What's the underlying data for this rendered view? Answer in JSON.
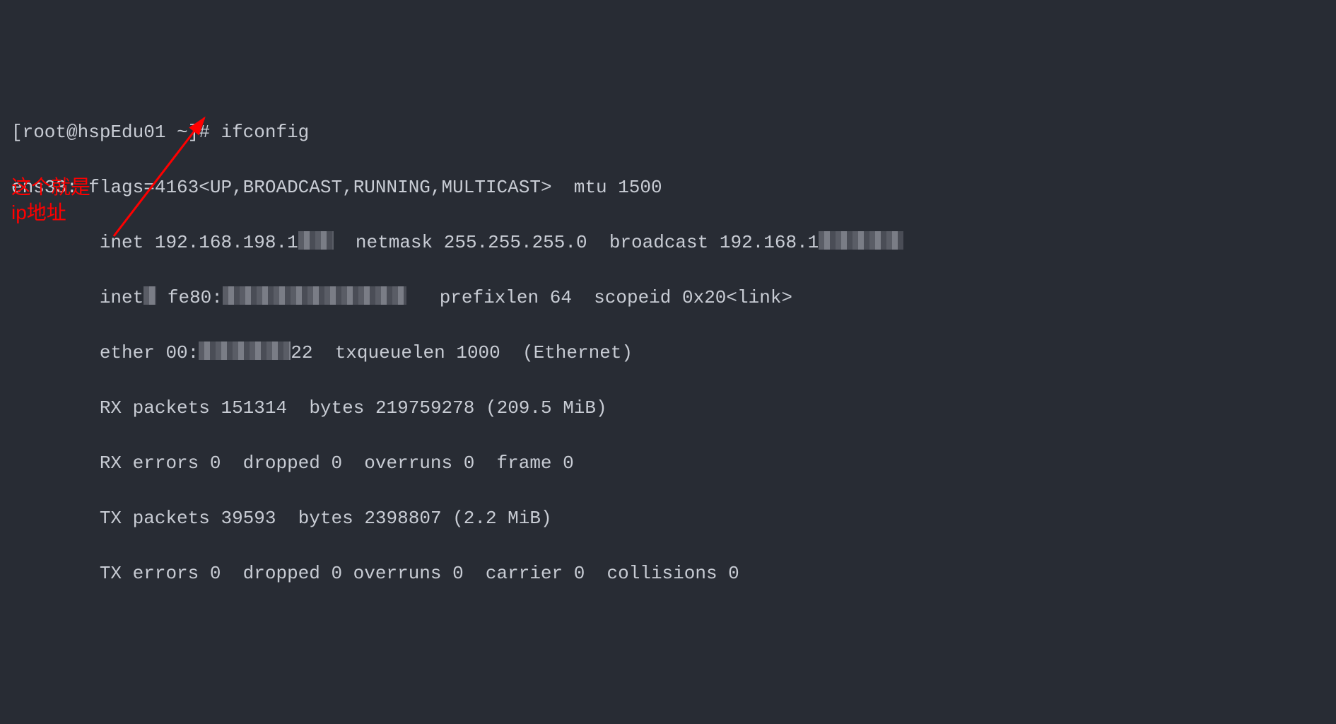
{
  "prompt": {
    "user_host": "[root@hspEdu01 ~]#",
    "command": "ifconfig"
  },
  "interface": {
    "name": "ens33:",
    "flags": "flags=4163<UP,BROADCAST,RUNNING,MULTICAST>",
    "mtu_label": "mtu",
    "mtu_value": "1500"
  },
  "inet": {
    "label": "inet",
    "ip_visible": "192.168.198.1",
    "netmask_label": "netmask",
    "netmask_value": "255.255.255.0",
    "broadcast_label": "broadcast",
    "broadcast_visible": "192.168.1"
  },
  "inet6": {
    "label_visible": "inet",
    "addr_visible": "fe80:",
    "prefixlen_label": "prefixlen",
    "prefixlen_value": "64",
    "scopeid_label": "scopeid",
    "scopeid_value": "0x20<link>"
  },
  "ether": {
    "label": "ether",
    "mac_visible_start": "00:",
    "mac_visible_end": "22",
    "txqueuelen_label": "txqueuelen",
    "txqueuelen_value": "1000",
    "type": "(Ethernet)"
  },
  "rx_packets": {
    "label": "RX packets",
    "count": "151314",
    "bytes_label": "bytes",
    "bytes_value": "219759278",
    "human": "(209.5 MiB)"
  },
  "rx_errors": {
    "line": "RX errors 0  dropped 0  overruns 0  frame 0"
  },
  "tx_packets": {
    "label": "TX packets",
    "count": "39593",
    "bytes_label": "bytes",
    "bytes_value": "2398807",
    "human": "(2.2 MiB)"
  },
  "tx_errors": {
    "line": "TX errors 0  dropped 0 overruns 0  carrier 0  collisions 0"
  },
  "annotation": {
    "line1": "这个就是",
    "line2": "ip地址"
  }
}
